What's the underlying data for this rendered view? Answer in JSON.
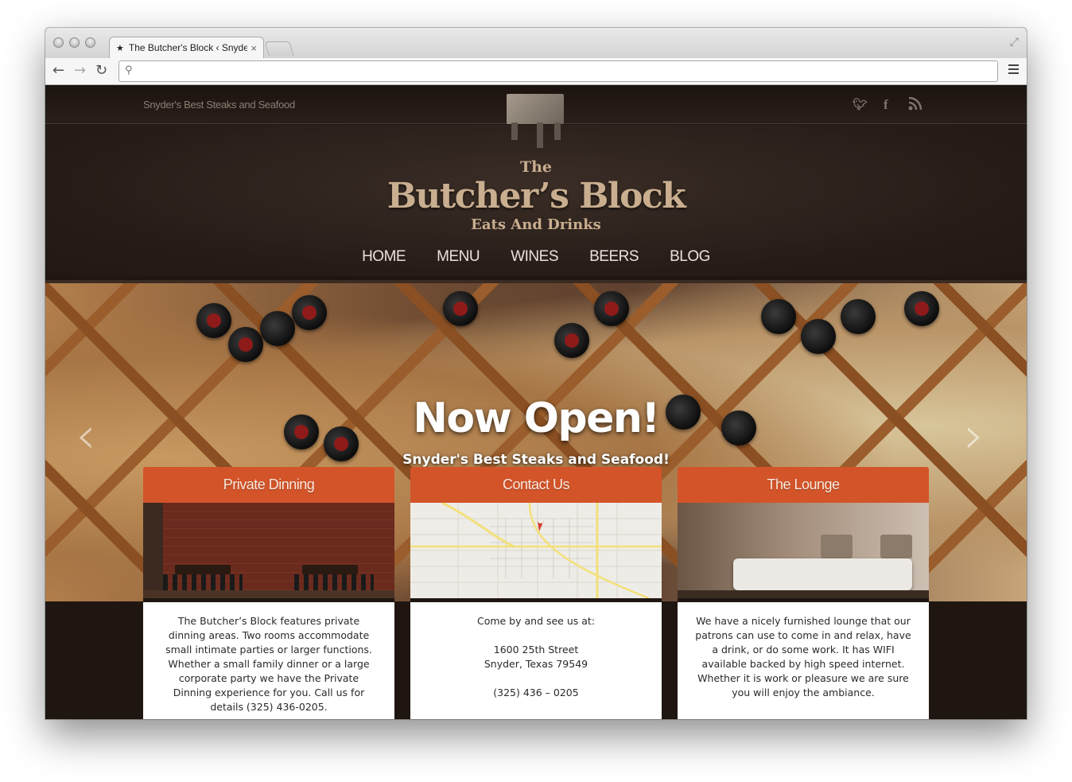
{
  "browser": {
    "tab_title": "The Butcher's Block ‹ Snyde",
    "tab_star": "★",
    "tab_close": "×",
    "url": "",
    "back": "←",
    "forward": "→",
    "reload": "↻",
    "search_glyph": "⚲",
    "fullscreen_glyph": "⤢"
  },
  "site": {
    "tagline": "Snyder's Best Steaks and Seafood",
    "social": [
      {
        "name": "twitter-icon",
        "glyph": "🐦"
      },
      {
        "name": "facebook-icon",
        "glyph": "f"
      },
      {
        "name": "rss-icon",
        "glyph": "◝"
      }
    ],
    "logo": {
      "the": "The",
      "name": "Butcher’s Block",
      "sub": "Eats And Drinks"
    },
    "nav": [
      "HOME",
      "MENU",
      "WINES",
      "BEERS",
      "BLOG"
    ],
    "hero": {
      "title": "Now Open!",
      "subtitle": "Snyder's Best Steaks and Seafood!",
      "prev": "‹",
      "next": "›"
    },
    "boxes": [
      {
        "title": "Private Dinning",
        "text": "The Butcher’s Block features private dinning areas.  Two rooms accommodate small intimate parties or larger functions.  Whether a small family dinner or a large corporate party we have the Private Dinning experience for you. Call us for details (325) 436-0205."
      },
      {
        "title": "Contact Us",
        "text": "Come by and see us at:\n\n1600 25th Street\nSnyder, Texas 79549\n\n(325) 436 – 0205"
      },
      {
        "title": "The Lounge",
        "text": "We have a nicely furnished lounge that our patrons can use to come in and relax, have a drink, or do some work.  It has WIFI available backed by high speed internet.  Whether it is work or pleasure we are sure you will enjoy the ambiance."
      }
    ],
    "accent_color": "#d35429",
    "logo_color": "#c9ae8f"
  }
}
